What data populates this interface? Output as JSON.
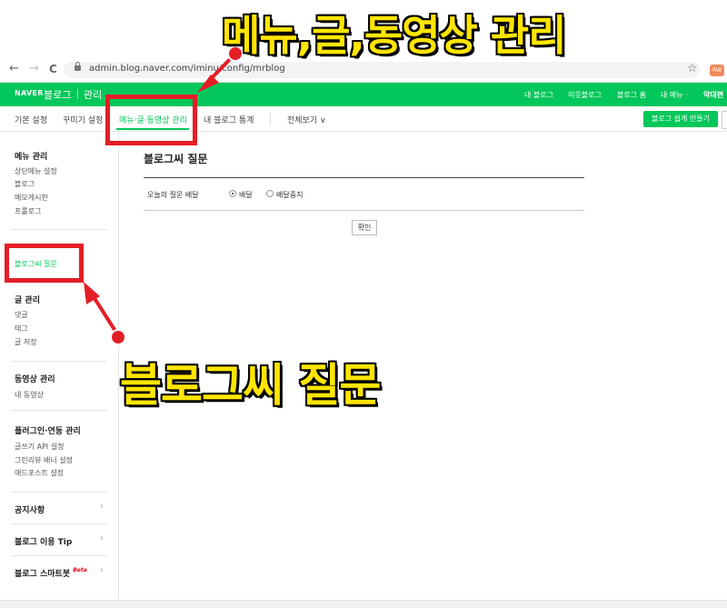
{
  "browser": {
    "back_glyph": "←",
    "forward_glyph": "→",
    "reload_glyph": "C",
    "url": "admin.blog.naver.com/iminu/config/mrblog",
    "star_glyph": "☆",
    "extension_label": "RW"
  },
  "topbar": {
    "brand": "NAVER",
    "blog": "블로그",
    "admin": "관리",
    "links": [
      "내 블로그",
      "이웃블로그",
      "블로그 홈",
      "내 메뉴 ·",
      "악대편"
    ]
  },
  "tabs": {
    "basic": "기본 설정",
    "decorate": "꾸미기 설정",
    "menu_post_video": "메뉴·글·동영상 관리",
    "stats": "내 블로그 통계",
    "view_all": "전체보기",
    "chevron": "∨",
    "easy_create": "블로그 쉽게 만들기"
  },
  "sidebar": {
    "menu_manage": {
      "title": "메뉴 관리",
      "items": [
        "상단메뉴 설정",
        "블로그",
        "메모게시판",
        "프롤로그"
      ]
    },
    "blog_question": "블로그씨 질문",
    "post_manage": {
      "title": "글 관리",
      "items": [
        "댓글",
        "태그",
        "글 저장"
      ]
    },
    "video_manage": {
      "title": "동영상 관리",
      "items": [
        "내 동영상"
      ]
    },
    "plugin_manage": {
      "title": "플러그인·연동 관리",
      "items": [
        "글쓰기 API 설정",
        "그린리뷰 배너 설정",
        "애드포스트 설정"
      ]
    },
    "notice": "공지사항",
    "tips": "블로그 이용 Tip",
    "smartbot": "블로그 스마트봇",
    "smartbot_badge": "Beta",
    "arrow_glyph": "›"
  },
  "main": {
    "title": "블로그씨 질문",
    "option_label": "오늘의 질문 배달",
    "radio_on": "배달",
    "radio_off": "배달중지",
    "confirm": "확인"
  },
  "annotations": {
    "top_caption": "메뉴,글,동영상 관리",
    "bottom_caption": "블로그씨 질문",
    "highlight_color": "#e41e26",
    "caption_color": "#ffe500"
  }
}
